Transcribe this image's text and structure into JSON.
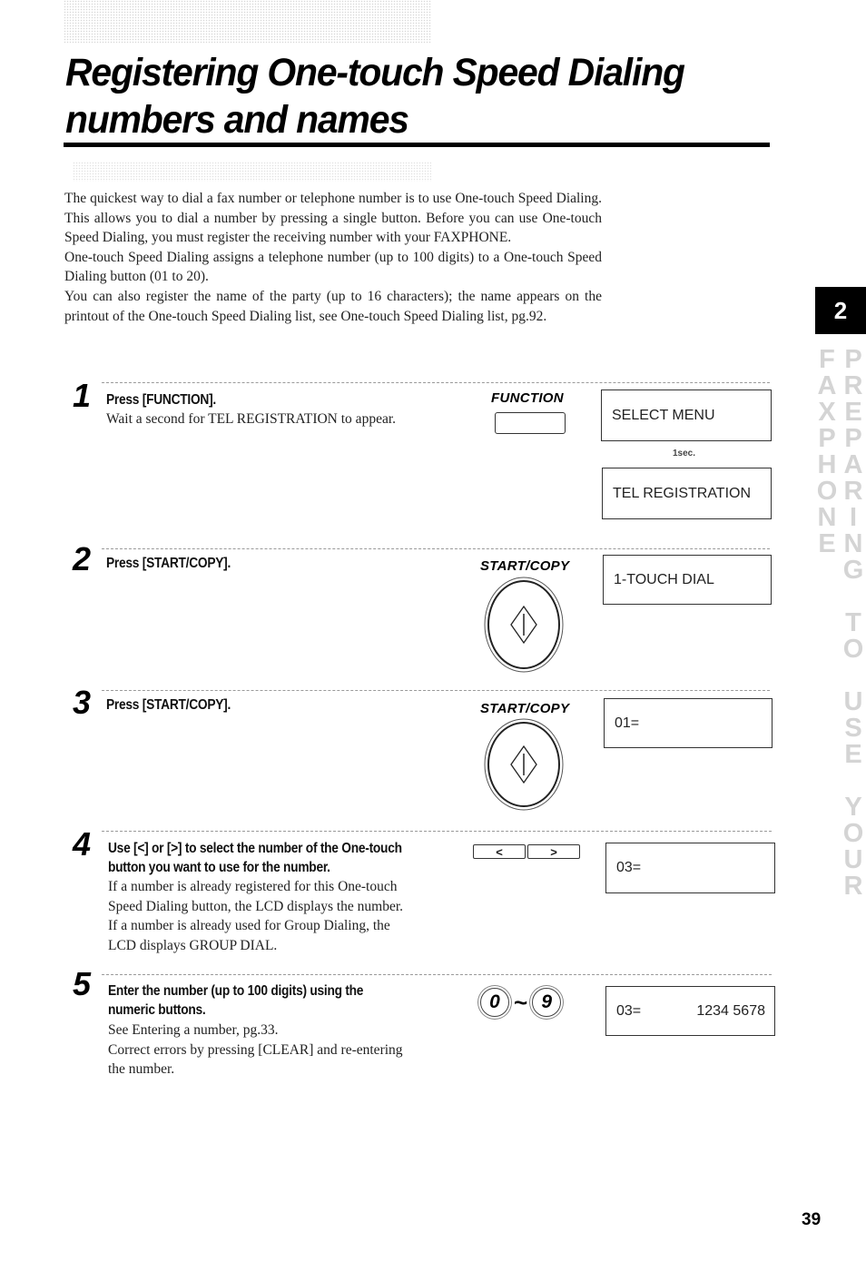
{
  "title": {
    "line1": "Registering One-touch Speed Dialing",
    "line2": "numbers and names"
  },
  "intro": {
    "paragraphs": [
      "The quickest way to dial a fax number or telephone number is to use One-touch Speed Dialing.  This allows you to dial a number by pressing a single button.  Before you can use One-touch Speed Dialing, you must register the receiving number with your FAXPHONE.",
      "One-touch Speed Dialing assigns a telephone number (up to 100 digits) to a One-touch Speed Dialing button (01 to 20).",
      "You can also register the name of the party (up to 16 characters); the name appears on the printout of the One-touch Speed Dialing list, see One-touch Speed Dialing list, pg.92."
    ]
  },
  "steps": [
    {
      "number": "1",
      "heading": "Press [FUNCTION].",
      "body": [
        "Wait a second for TEL REGISTRATION to appear."
      ],
      "key_label": "FUNCTION",
      "key_icon": "function-key-icon",
      "lcd": [
        "SELECT MENU",
        "TEL REGISTRATION"
      ],
      "delay_label": "1sec."
    },
    {
      "number": "2",
      "heading": "Press [START/COPY].",
      "body": [],
      "key_label": "START/COPY",
      "key_icon": "start-copy-button-icon",
      "lcd": [
        "1-TOUCH DIAL"
      ]
    },
    {
      "number": "3",
      "heading": "Press [START/COPY].",
      "body": [],
      "key_label": "START/COPY",
      "key_icon": "start-copy-button-icon",
      "lcd": [
        "01="
      ]
    },
    {
      "number": "4",
      "heading": [
        "Use [<] or [>] to select the number of the One-touch",
        "button you want to use for the number."
      ],
      "body": [
        "If a number is already registered for this One-touch",
        "Speed Dialing button, the LCD displays the number.",
        "If a number is already used for Group Dialing, the",
        "LCD displays GROUP DIAL."
      ],
      "keys": [
        "<",
        ">"
      ],
      "lcd": [
        "03="
      ]
    },
    {
      "number": "5",
      "heading": [
        "Enter the number (up to 100 digits) using the",
        "numeric buttons."
      ],
      "body": [
        "See Entering a number, pg.33.",
        "Correct errors by pressing [CLEAR] and re-entering",
        "the number."
      ],
      "keys": [
        "0",
        "~",
        "9"
      ],
      "lcd": [
        "03="
      ],
      "lcd_value": "1234 5678"
    }
  ],
  "sidebar": {
    "chapter_number": "2",
    "chapter_title": "PREPARING TO USE YOUR FAXPHONE"
  },
  "page_number": "39"
}
